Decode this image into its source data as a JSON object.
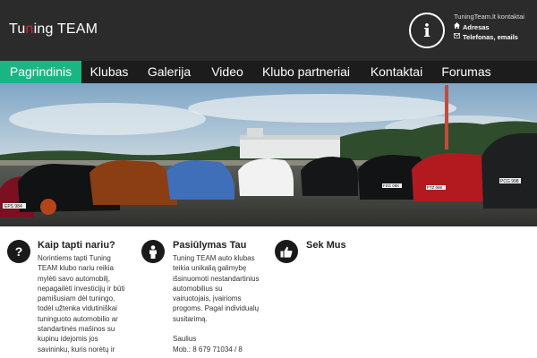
{
  "header": {
    "logo_prefix": "Tu",
    "logo_accent": "n",
    "logo_suffix": "ing TEAM",
    "contacts_title": "TuningTeam.lt kontaktai",
    "address_label": "Adresas",
    "phone_email_label": "Telefonas, emails",
    "info_icon": "info-icon",
    "address_icon": "home-icon",
    "phone_icon": "envelope-icon"
  },
  "nav": {
    "items": [
      {
        "label": "Pagrindinis",
        "active": true
      },
      {
        "label": "Klubas"
      },
      {
        "label": "Galerija"
      },
      {
        "label": "Video"
      },
      {
        "label": "Klubo partneriai"
      },
      {
        "label": "Kontaktai"
      },
      {
        "label": "Forumas"
      }
    ]
  },
  "hero": {
    "plates": [
      "EPS 984",
      "",
      "",
      "",
      "",
      "",
      "",
      "FZG 088",
      "FTZ 068",
      "PCG 998"
    ]
  },
  "columns": [
    {
      "icon": "question-icon",
      "title": "Kaip tapti nariu?",
      "lines": [
        "Norintiems tapti Tuning",
        "TEAM klubo nariu reikia",
        "mylėti savo automobilį,",
        "nepagailėti investicijų ir būti",
        "pamišusiam dėl tuningo,",
        "todėl užtenka vidutiniškai",
        "tuninguoto automobilio ar",
        "standartinės mašinos su",
        "kupinu idejomis jos",
        "savininku, kuris norėtų ir"
      ]
    },
    {
      "icon": "person-icon",
      "title": "Pasiūlymas Tau",
      "lines": [
        "Tuning TEAM auto klubas",
        "teikia unikalią galimybę",
        "išsinuomoti nestandartinius",
        "automobilius su",
        "vairuotojais, įvairioms",
        "progoms. Pagal individualų",
        "susitarimą.",
        "",
        "Saulius",
        "Mob.: 8 679 71034 / 8"
      ]
    },
    {
      "icon": "thumbs-up-icon",
      "title": "Sek Mus",
      "lines": []
    }
  ],
  "colors": {
    "header_bg": "#2b2b2b",
    "nav_bg": "#1c1c1c",
    "nav_active": "#1bb584",
    "accent_red": "#d72828"
  }
}
